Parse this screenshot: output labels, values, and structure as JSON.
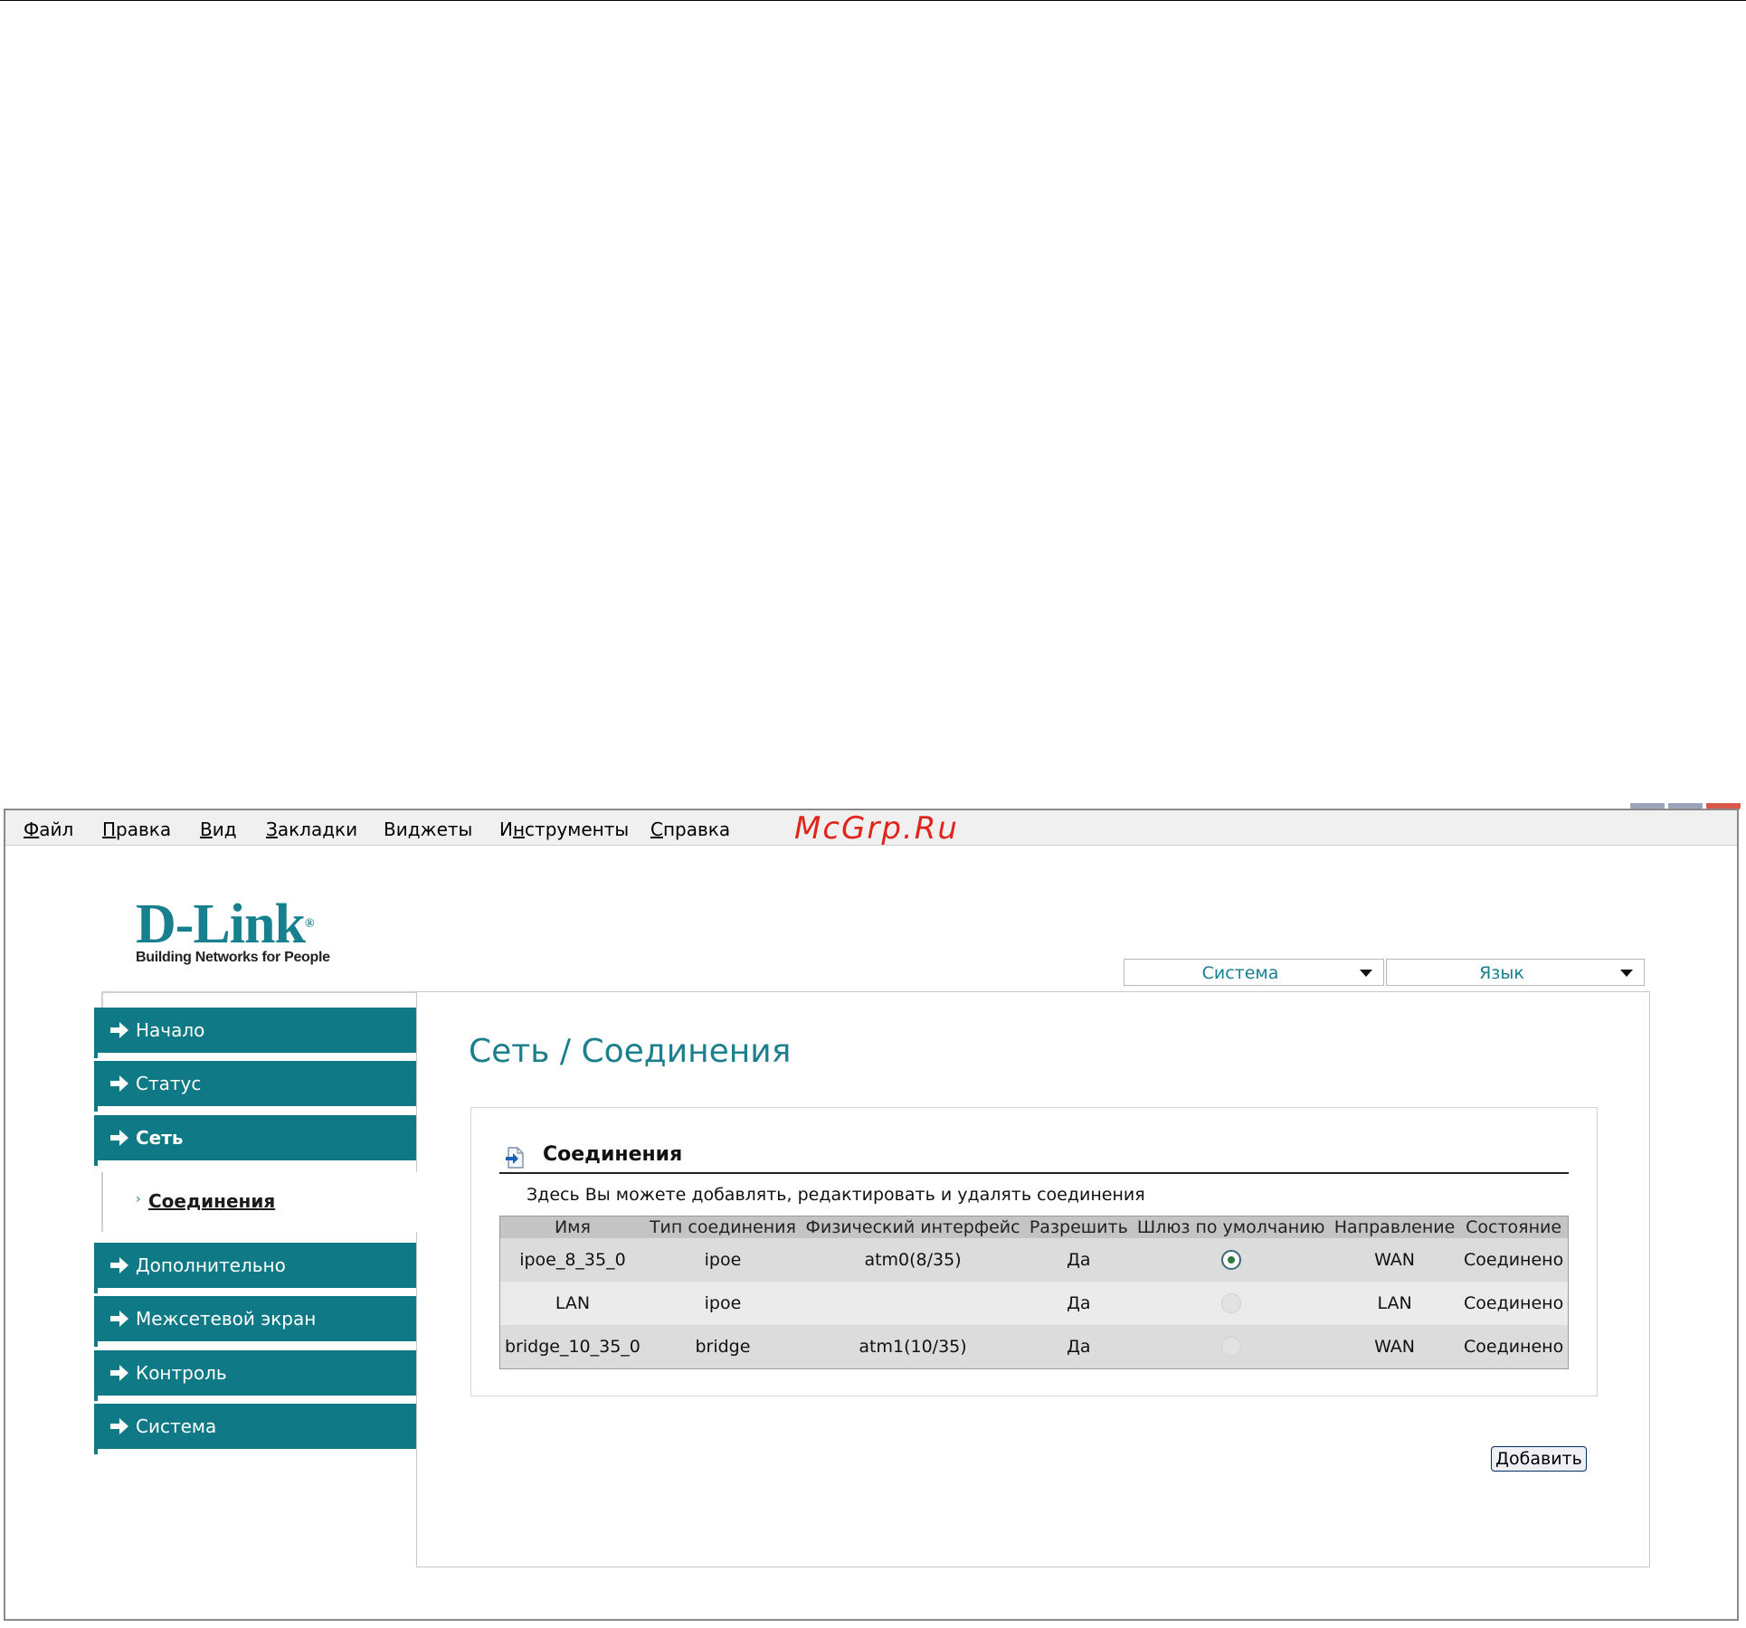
{
  "watermark": "McGrp.Ru",
  "menubar": [
    {
      "prefix": "",
      "hot": "Ф",
      "rest": "айл"
    },
    {
      "prefix": "",
      "hot": "П",
      "rest": "равка"
    },
    {
      "prefix": "",
      "hot": "В",
      "rest": "ид"
    },
    {
      "prefix": "",
      "hot": "З",
      "rest": "акладки"
    },
    {
      "prefix": "Ви",
      "hot": "д",
      "rest": "жеты"
    },
    {
      "prefix": "И",
      "hot": "н",
      "rest": "струменты"
    },
    {
      "prefix": "",
      "hot": "С",
      "rest": "правка"
    }
  ],
  "logo": {
    "name": "D-Link",
    "registered": "®",
    "tagline": "Building Networks for People"
  },
  "top_selects": {
    "system": "Система",
    "language": "Язык"
  },
  "sidebar": {
    "items": [
      {
        "label": "Начало"
      },
      {
        "label": "Статус"
      },
      {
        "label": "Сеть"
      },
      {
        "label": "Дополнительно"
      },
      {
        "label": "Межсетевой экран"
      },
      {
        "label": "Контроль"
      },
      {
        "label": "Система"
      }
    ],
    "sub_item": "Соединения",
    "sub_bullet": "›"
  },
  "page_title": "Сеть / Соединения",
  "section": {
    "title": "Соединения",
    "description": "Здесь Вы можете добавлять, редактировать и удалять соединения"
  },
  "table": {
    "headers": [
      "Имя",
      "Тип соединения",
      "Физический интерфейс",
      "Разрешить",
      "Шлюз по умолчанию",
      "Направление",
      "Состояние"
    ],
    "rows": [
      {
        "name": "ipoe_8_35_0",
        "type": "ipoe",
        "iface": "atm0(8/35)",
        "enabled": "Да",
        "default_gw": true,
        "direction": "WAN",
        "state": "Соединено"
      },
      {
        "name": "LAN",
        "type": "ipoe",
        "iface": "",
        "enabled": "Да",
        "default_gw": false,
        "direction": "LAN",
        "state": "Соединено"
      },
      {
        "name": "bridge_10_35_0",
        "type": "bridge",
        "iface": "atm1(10/35)",
        "enabled": "Да",
        "default_gw": false,
        "direction": "WAN",
        "state": "Соединено"
      }
    ]
  },
  "add_button": "Добавить",
  "colors": {
    "accent": "#0f7a86",
    "title": "#1c7f8e",
    "watermark": "#e0261b"
  }
}
